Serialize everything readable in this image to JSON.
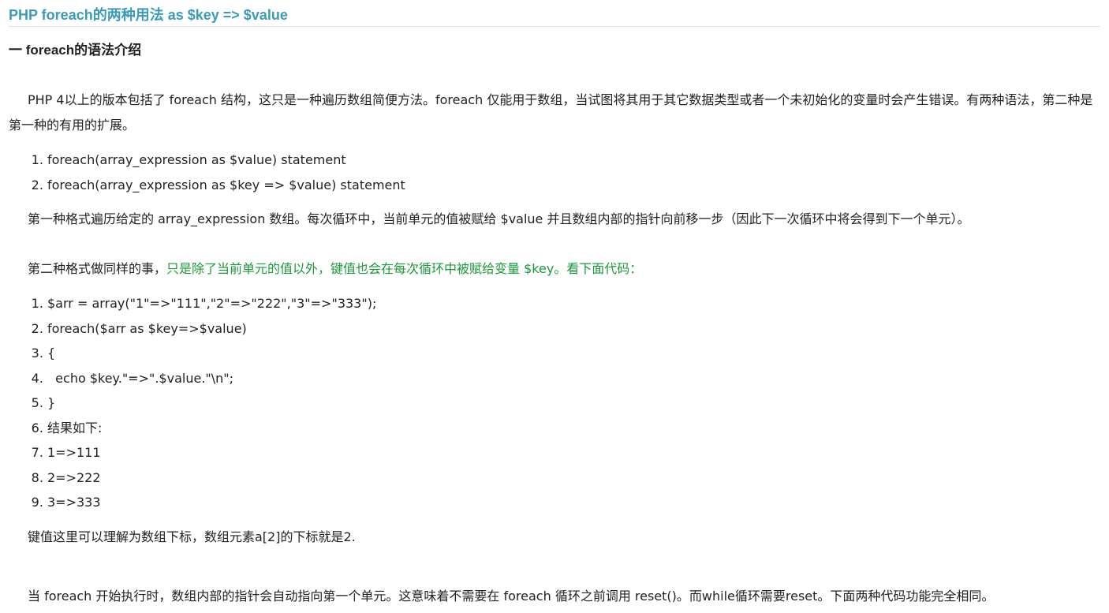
{
  "article": {
    "title": "PHP foreach的两种用法 as $key => $value",
    "section_heading": "一 foreach的语法介绍",
    "intro_paragraph": "PHP 4以上的版本包括了 foreach 结构，这只是一种遍历数组简便方法。foreach 仅能用于数组，当试图将其用于其它数据类型或者一个未初始化的变量时会产生错误。有两种语法，第二种是第一种的有用的扩展。",
    "syntax_list": [
      {
        "num": "1.",
        "text": "foreach(array_expression as $value) statement"
      },
      {
        "num": "2.",
        "text": "foreach(array_expression as $key => $value) statement"
      }
    ],
    "format_one_paragraph": "第一种格式遍历给定的 array_expression 数组。每次循环中，当前单元的值被赋给 $value 并且数组内部的指针向前移一步（因此下一次循环中将会得到下一个单元）。",
    "format_two_prefix": "第二种格式做同样的事，",
    "format_two_highlight": "只是除了当前单元的值以外，键值也会在每次循环中被赋给变量 $key。看下面代码：",
    "code_lines": [
      {
        "num": "1.",
        "text": "$arr = array(\"1\"=>\"111\",\"2\"=>\"222\",\"3\"=>\"333\");"
      },
      {
        "num": "2.",
        "text": "foreach($arr as $key=>$value)"
      },
      {
        "num": "3.",
        "text": "{"
      },
      {
        "num": "4.",
        "text": "  echo $key.\"=>\".$value.\"\\n\";"
      },
      {
        "num": "5.",
        "text": "}"
      },
      {
        "num": "6.",
        "text": "结果如下:"
      },
      {
        "num": "7.",
        "text": "1=>111"
      },
      {
        "num": "8.",
        "text": "2=>222"
      },
      {
        "num": "9.",
        "text": "3=>333"
      }
    ],
    "key_paragraph": "键值这里可以理解为数组下标，数组元素a[2]的下标就是2.",
    "pointer_paragraph": "当 foreach 开始执行时，数组内部的指针会自动指向第一个单元。这意味着不需要在 foreach 循环之前调用 reset()。而while循环需要reset。下面两种代码功能完全相同。"
  }
}
